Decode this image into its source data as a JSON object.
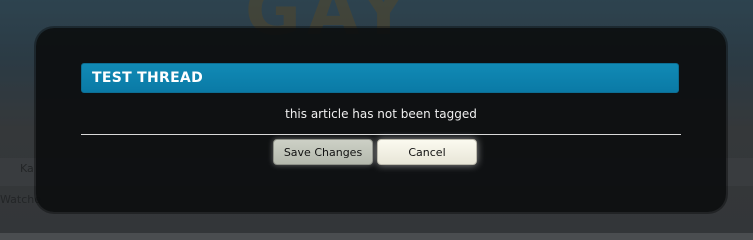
{
  "background": {
    "logo_text": "GAY",
    "strip_text": "Ka",
    "footer_text": "Watche"
  },
  "dialog": {
    "title": "TEST THREAD",
    "message": "this article has not been tagged",
    "save_label": "Save Changes",
    "cancel_label": "Cancel"
  },
  "colors": {
    "header_bg": "#0a7aa6",
    "modal_bg": "#0c0e0f",
    "save_bg": "#c2c5bb",
    "cancel_bg": "#f2f0e4"
  }
}
